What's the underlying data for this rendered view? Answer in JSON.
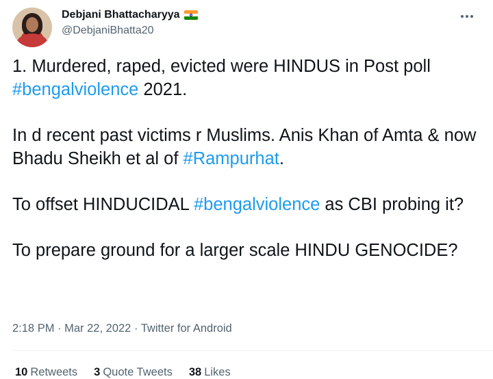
{
  "author": {
    "display_name": "Debjani Bhattacharyya",
    "handle": "@DebjaniBhatta20",
    "flag": "india-flag-icon"
  },
  "tweet": {
    "p1_text_a": "1. Murdered, raped, evicted were HINDUS in Post poll ",
    "p1_hashtag": "#bengalviolence",
    "p1_text_b": " 2021.",
    "p2_text_a": "In d recent past victims r Muslims. Anis Khan of Amta & now Bhadu Sheikh et al of ",
    "p2_hashtag": "#Rampurhat",
    "p2_text_b": ".",
    "p3_text_a": "To offset HINDUCIDAL ",
    "p3_hashtag": "#bengalviolence",
    "p3_text_b": " as CBI probing it?",
    "p4_text": "To prepare ground for a larger scale HINDU GENOCIDE?"
  },
  "meta": {
    "time": "2:18 PM",
    "sep1": " · ",
    "date": "Mar 22, 2022",
    "sep2": " · ",
    "source": "Twitter for Android"
  },
  "stats": {
    "retweets_count": "10",
    "retweets_label": "Retweets",
    "quotes_count": "3",
    "quotes_label": "Quote Tweets",
    "likes_count": "38",
    "likes_label": "Likes"
  },
  "colors": {
    "link": "#1d9bf0",
    "text": "#0f1419",
    "secondary": "#536471"
  }
}
